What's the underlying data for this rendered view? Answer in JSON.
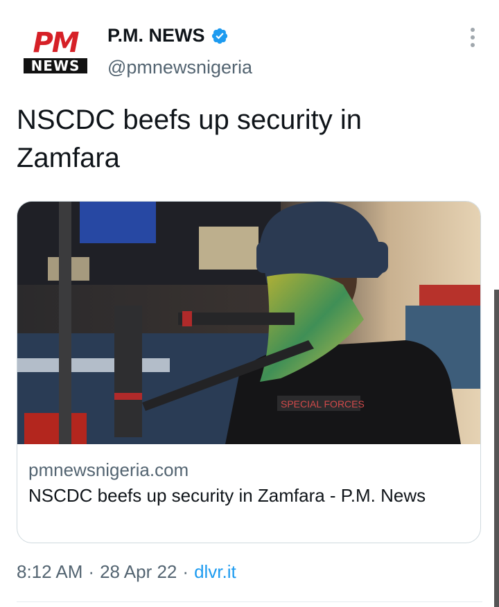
{
  "account": {
    "logo_top": "PM",
    "logo_bottom": "NEWS",
    "name": "P.M. NEWS",
    "handle": "@pmnewsnigeria",
    "verified_icon": "verified-badge-icon"
  },
  "tweet": {
    "text": "NSCDC beefs up security in Zamfara"
  },
  "card": {
    "domain": "pmnewsnigeria.com",
    "title": "NSCDC beefs up security in Zamfara - P.M. News",
    "image_label": "SPECIAL FORCES"
  },
  "meta": {
    "time": "8:12 AM",
    "date": "28 Apr 22",
    "source": "dlvr.it",
    "sep": "·"
  },
  "colors": {
    "accent": "#1d9bf0",
    "logo_red": "#d62027"
  }
}
